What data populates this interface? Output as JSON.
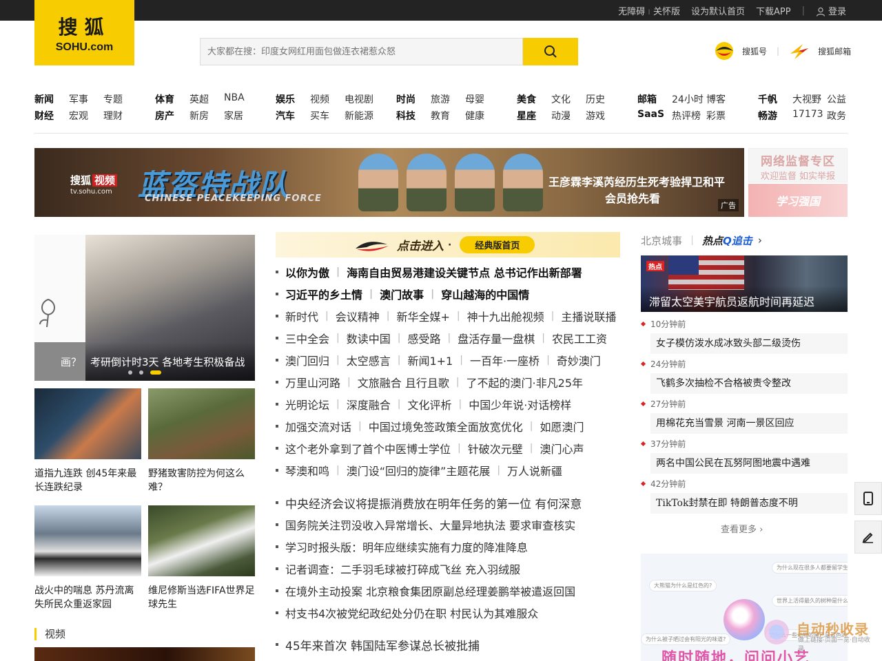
{
  "topbar": {
    "accessibility": "无障碍",
    "care_mode": "关怀版",
    "set_home": "设为默认首页",
    "download_app": "下载APP",
    "login": "登录"
  },
  "logo": {
    "cn": "搜狐",
    "en": "SOHU.com"
  },
  "search": {
    "placeholder": "大家都在搜：印度女网红用面包做连衣裙惹众怒"
  },
  "header_links": {
    "sohu_hao": "搜狐号",
    "sohu_mail": "搜狐邮箱"
  },
  "nav": {
    "groups": [
      {
        "rows": [
          [
            "新闻",
            "军事",
            "专题"
          ],
          [
            "财经",
            "宏观",
            "理财"
          ]
        ]
      },
      {
        "rows": [
          [
            "体育",
            "英超",
            "NBA"
          ],
          [
            "房产",
            "新房",
            "家居"
          ]
        ]
      },
      {
        "rows": [
          [
            "娱乐",
            "视频",
            "电视剧"
          ],
          [
            "汽车",
            "买车",
            "新能源"
          ]
        ]
      },
      {
        "rows": [
          [
            "时尚",
            "旅游",
            "母婴"
          ],
          [
            "科技",
            "教育",
            "健康"
          ]
        ]
      },
      {
        "rows": [
          [
            "美食",
            "文化",
            "历史"
          ],
          [
            "星座",
            "动漫",
            "游戏"
          ]
        ]
      },
      {
        "rows": [
          [
            "邮箱",
            "24小时",
            "博客"
          ],
          [
            "SaaS",
            "热评榜",
            "彩票"
          ]
        ]
      },
      {
        "rows": [
          [
            "千帆",
            "大视野",
            "公益"
          ],
          [
            "畅游",
            "17173",
            "政务"
          ]
        ]
      }
    ]
  },
  "banner": {
    "brand": "搜狐",
    "brand_tag": "视频",
    "url": "tv.sohu.com",
    "title": "蓝盔特战队",
    "title_en": "CHINESE PEACEKEEPING FORCE",
    "slogan1": "王彦霖李溪芮经历生死考验捍卫和平",
    "slogan2": "会员抢先看",
    "ad_label": "广告"
  },
  "side_ads": {
    "ad1_title": "网络监督专区",
    "ad1_sub": "欢迎监督  如实举报",
    "ad2": "学习强国"
  },
  "slider": {
    "left_caption": "画？",
    "caption": "考研倒计时3天 各地考生积极备战"
  },
  "cards": [
    {
      "text": "道指九连跌 创45年来最长连跌纪录"
    },
    {
      "text": "野猪致害防控为何这么难？"
    },
    {
      "text": "战火中的喘息 苏丹流离失所民众重返家园"
    },
    {
      "text": "维尼修斯当选FIFA世界足球先生"
    }
  ],
  "video_section": {
    "title": "视频"
  },
  "enter_bar": {
    "go": "点击进入",
    "pill": "经典版首页"
  },
  "news_groups": {
    "group1": [
      {
        "bold": true,
        "items": [
          "以你为傲",
          "海南自由贸易港建设关键节点 总书记作出新部署"
        ]
      },
      {
        "bold": true,
        "items": [
          "习近平的乡土情",
          "澳门故事",
          "穿山越海的中国情"
        ]
      },
      {
        "bold": false,
        "items": [
          "新时代",
          "会议精神",
          "新华全媒+",
          "神十九出舱视频",
          "主播说联播"
        ]
      },
      {
        "bold": false,
        "items": [
          "三中全会",
          "数读中国",
          "感受路",
          "盘活存量一盘棋",
          "农民工工资"
        ]
      },
      {
        "bold": false,
        "items": [
          "澳门回归",
          "太空感言",
          "新闻1+1",
          "一百年·一座桥",
          "奇妙澳门"
        ]
      },
      {
        "bold": false,
        "items": [
          "万里山河路",
          "文旅融合 且行且歌",
          "了不起的澳门·非凡25年"
        ]
      },
      {
        "bold": false,
        "items": [
          "光明论坛",
          "深度融合",
          "文化评析",
          "中国少年说·对话榜样"
        ]
      },
      {
        "bold": false,
        "items": [
          "加强交流对话",
          "中国过境免签政策全面放宽优化",
          "如愿澳门"
        ]
      },
      {
        "bold": false,
        "items": [
          "这个老外拿到了首个中医博士学位",
          "针破次元壁",
          "澳门心声"
        ]
      },
      {
        "bold": false,
        "items": [
          "琴澳和鸣",
          "澳门设“回归的旋律”主题花展",
          "万人说新疆"
        ]
      }
    ],
    "group2": [
      {
        "big": true,
        "items": [
          "中央经济会议将提振消费放在明年任务的第一位 有何深意"
        ]
      },
      {
        "big": false,
        "items": [
          "国务院关注罚没收入异常增长、大量异地执法 要求审查核实"
        ]
      },
      {
        "big": false,
        "items": [
          "学习时报头版：明年应继续实施有力度的降准降息"
        ]
      },
      {
        "big": false,
        "items": [
          "记者调查：二手羽毛球被打碎成飞丝 充入羽绒服"
        ]
      },
      {
        "big": false,
        "items": [
          "在境外主动投案 北京粮食集团原副总经理姜鹏举被遣返回国"
        ]
      },
      {
        "big": false,
        "items": [
          "村支书4次被党纪政纪处分仍在职 村民认为其难服众"
        ]
      }
    ],
    "group3": [
      {
        "big": true,
        "items": [
          "45年来首次 韩国陆军参谋总长被批捕"
        ]
      }
    ]
  },
  "city": {
    "title": "北京城事",
    "hot_a": "热点",
    "hot_q": "Q",
    "hot_b": "追击",
    "image_tag": "热点",
    "image_caption": "滞留太空美宇航员返航时间再延迟"
  },
  "time_items": [
    {
      "time": "10分钟前",
      "text": "女子模仿泼水成冰致头部二级烫伤"
    },
    {
      "time": "24分钟前",
      "text": "飞鹤多次抽检不合格被责令整改"
    },
    {
      "time": "27分钟前",
      "text": "用棉花充当雪景 河南一景区回应"
    },
    {
      "time": "37分钟前",
      "text": "两名中国公民在瓦努阿图地震中遇难"
    },
    {
      "time": "42分钟前",
      "text": "TikTok封禁在即 特朗普态度不明"
    }
  ],
  "more": "查看更多",
  "qa_ad": {
    "bubbles": [
      "为什么现在很多人都要留学生?",
      "大熊猫为什么是红色的?",
      "世界上活得最久的树种是什么?",
      "为什么被子晒过会有阳光的味道?",
      "为什么一些动物的尾巴是蓝色的?"
    ],
    "slogan": "随时随地，问问小艺"
  },
  "watermark": {
    "title": "自动秒收录",
    "sub": "做上链接·页面一览·自动收录"
  },
  "colors": {
    "brand": "#f7cc00",
    "topbar": "#232323",
    "accent_red": "#dd2222"
  }
}
